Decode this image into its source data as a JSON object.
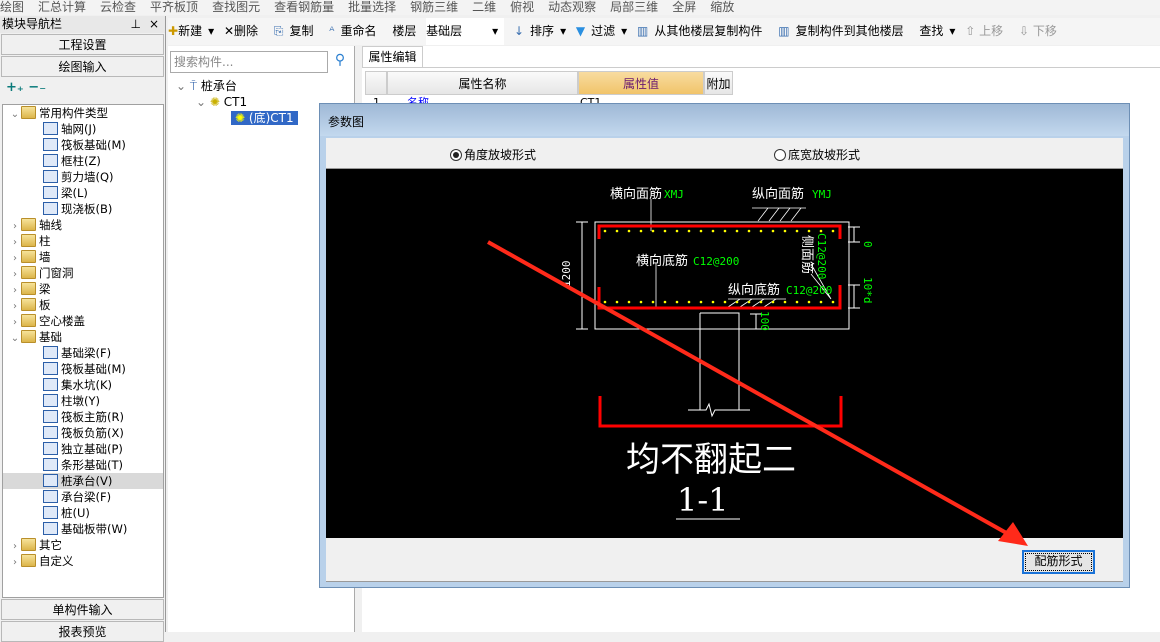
{
  "top_toolbar": {
    "items": [
      "绘图",
      "汇总计算",
      "云检查",
      "平齐板顶",
      "查找图元",
      "查看钢筋量",
      "批量选择",
      "钢筋三维",
      "二维",
      "俯视",
      "动态观察",
      "局部三维",
      "全屏",
      "缩放"
    ]
  },
  "nav": {
    "title": "模块导航栏",
    "pin": "ꟼ",
    "close": "×",
    "project_settings": "工程设置",
    "drawing_input": "绘图输入",
    "single_input": "单构件输入",
    "report_preview": "报表预览",
    "tree": [
      {
        "label": "常用构件类型",
        "level": 0,
        "expanded": true,
        "folder": true
      },
      {
        "label": "轴网(J)",
        "level": 1
      },
      {
        "label": "筏板基础(M)",
        "level": 1
      },
      {
        "label": "框柱(Z)",
        "level": 1
      },
      {
        "label": "剪力墙(Q)",
        "level": 1
      },
      {
        "label": "梁(L)",
        "level": 1
      },
      {
        "label": "现浇板(B)",
        "level": 1
      },
      {
        "label": "轴线",
        "level": 0,
        "folder": true
      },
      {
        "label": "柱",
        "level": 0,
        "folder": true
      },
      {
        "label": "墙",
        "level": 0,
        "folder": true
      },
      {
        "label": "门窗洞",
        "level": 0,
        "folder": true
      },
      {
        "label": "梁",
        "level": 0,
        "folder": true
      },
      {
        "label": "板",
        "level": 0,
        "folder": true
      },
      {
        "label": "空心楼盖",
        "level": 0,
        "folder": true
      },
      {
        "label": "基础",
        "level": 0,
        "expanded": true,
        "folder": true
      },
      {
        "label": "基础梁(F)",
        "level": 1
      },
      {
        "label": "筏板基础(M)",
        "level": 1
      },
      {
        "label": "集水坑(K)",
        "level": 1
      },
      {
        "label": "柱墩(Y)",
        "level": 1
      },
      {
        "label": "筏板主筋(R)",
        "level": 1
      },
      {
        "label": "筏板负筋(X)",
        "level": 1
      },
      {
        "label": "独立基础(P)",
        "level": 1
      },
      {
        "label": "条形基础(T)",
        "level": 1
      },
      {
        "label": "桩承台(V)",
        "level": 1,
        "selected": true
      },
      {
        "label": "承台梁(F)",
        "level": 1
      },
      {
        "label": "桩(U)",
        "level": 1
      },
      {
        "label": "基础板带(W)",
        "level": 1
      },
      {
        "label": "其它",
        "level": 0,
        "folder": true
      },
      {
        "label": "自定义",
        "level": 0,
        "folder": true
      }
    ]
  },
  "toolbar": {
    "new": "新建",
    "delete": "删除",
    "copy": "复制",
    "rename": "重命名",
    "floor_label": "楼层",
    "floor_value": "基础层",
    "sort": "排序",
    "filter": "过滤",
    "copy_from": "从其他楼层复制构件",
    "copy_to": "复制构件到其他楼层",
    "find": "查找",
    "move_up": "上移",
    "move_down": "下移"
  },
  "components": {
    "search_placeholder": "搜索构件...",
    "root": "桩承台",
    "child": "CT1",
    "leaf": "(底)CT1"
  },
  "properties": {
    "tab": "属性编辑",
    "col_name": "属性名称",
    "col_value": "属性值",
    "col_extra": "附加",
    "rows": [
      {
        "index": "1",
        "name": "名称",
        "value": "CT1"
      }
    ]
  },
  "dialog": {
    "title": "参数图",
    "radio_angle": "角度放坡形式",
    "radio_width": "底宽放坡形式",
    "selected": "angle",
    "button": "配筋形式",
    "drawing": {
      "top_transverse": "横向面筋",
      "top_transverse_val": "XMJ",
      "top_long": "纵向面筋",
      "top_long_val": "YMJ",
      "bot_transverse": "横向底筋",
      "bot_transverse_val": "C12@200",
      "bot_long": "纵向底筋",
      "bot_long_val": "C12@200",
      "side": "侧面筋",
      "side_val": "C12@200",
      "dim_height": "1200",
      "dim_top": "0",
      "dim_side": "10*d",
      "dim_embed": "100",
      "caption": "均不翻起二",
      "section": "1-1"
    }
  },
  "colors": {
    "accent": "#3168c6",
    "header_highlight": "#f3c873",
    "rebar": "#ff0000",
    "annotation": "#00ff00",
    "arrow": "#ff2a1a"
  }
}
